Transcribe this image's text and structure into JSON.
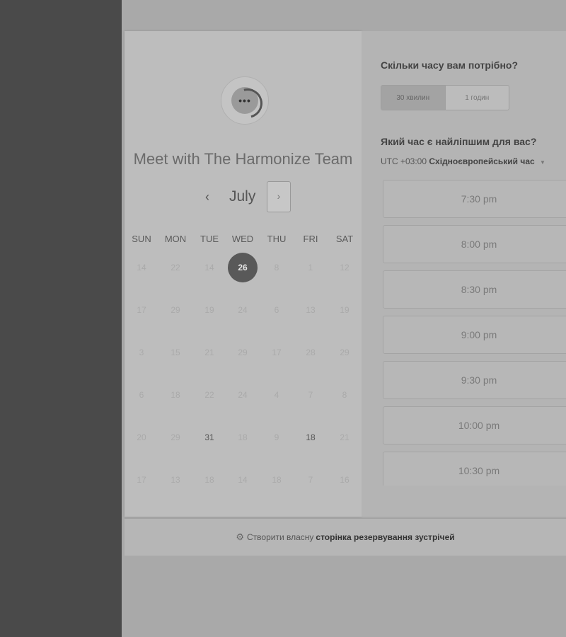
{
  "calendar": {
    "title": "Meet with The Harmonize Team",
    "month": "July",
    "prev_icon": "‹",
    "next_icon": "›",
    "weekdays": [
      "SUN",
      "MON",
      "TUE",
      "WED",
      "THU",
      "FRI",
      "SAT"
    ],
    "weeks": [
      [
        "14",
        "22",
        "14",
        "26",
        "8",
        "1",
        "12"
      ],
      [
        "17",
        "29",
        "19",
        "24",
        "6",
        "13",
        "19"
      ],
      [
        "3",
        "15",
        "21",
        "29",
        "17",
        "28",
        "29"
      ],
      [
        "6",
        "18",
        "22",
        "24",
        "4",
        "7",
        "8"
      ],
      [
        "20",
        "29",
        "31",
        "18",
        "9",
        "18",
        "21"
      ],
      [
        "17",
        "13",
        "18",
        "14",
        "18",
        "7",
        "16"
      ]
    ],
    "selected_day": "26",
    "bold_days": [
      "31",
      "18"
    ]
  },
  "booking": {
    "duration_question": "Скільки часу вам потрібно?",
    "durations": [
      "30 хвилин",
      "1 годин"
    ],
    "time_question": "Який час є найліпшим для вас?",
    "timezone_offset": "UTC +03:00",
    "timezone_name": "Східноєвропейський час",
    "slots": [
      "7:30 pm",
      "8:00 pm",
      "8:30 pm",
      "9:00 pm",
      "9:30 pm",
      "10:00 pm",
      "10:30 pm"
    ]
  },
  "footer": {
    "prefix": "Створити власну",
    "link": "сторінка резервування зустрічей"
  }
}
